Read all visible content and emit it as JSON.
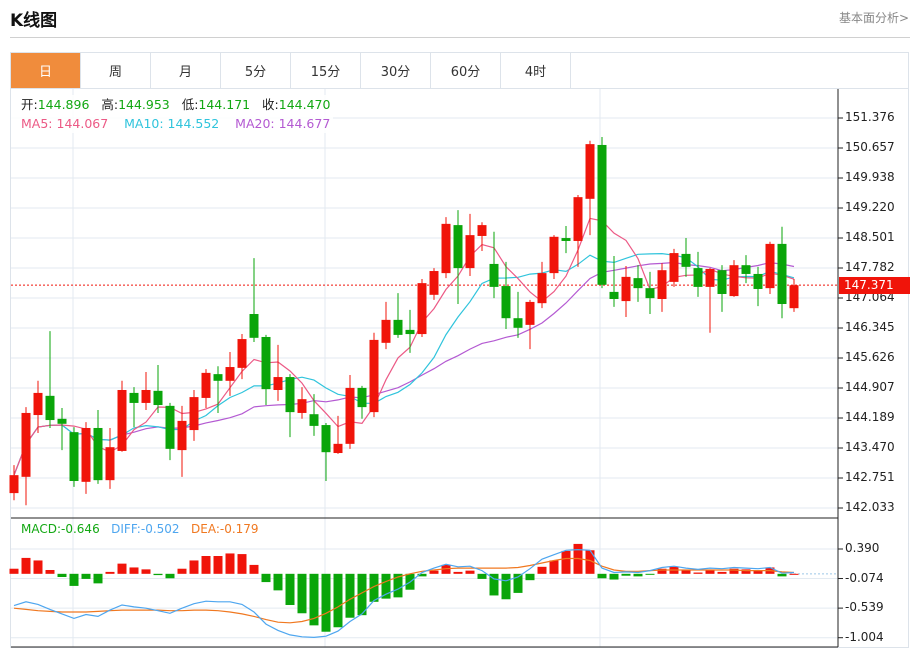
{
  "header": {
    "title": "K线图",
    "link": "基本面分析>"
  },
  "tabs": [
    {
      "label": "日",
      "active": true
    },
    {
      "label": "周"
    },
    {
      "label": "月"
    },
    {
      "label": "5分"
    },
    {
      "label": "15分"
    },
    {
      "label": "30分"
    },
    {
      "label": "60分"
    },
    {
      "label": "4时"
    }
  ],
  "ohlc": {
    "open_label": "开:",
    "open": "144.896",
    "high_label": "高:",
    "high": "144.953",
    "low_label": "低:",
    "low": "144.171",
    "close_label": "收:",
    "close": "144.470"
  },
  "ma": {
    "ma5_label": "MA5:",
    "ma5": "144.067",
    "ma10_label": "MA10:",
    "ma10": "144.552",
    "ma20_label": "MA20:",
    "ma20": "144.677"
  },
  "macd_info": {
    "macd_label": "MACD:",
    "macd": "-0.646",
    "diff_label": "DIFF:",
    "diff": "-0.502",
    "dea_label": "DEA:",
    "dea": "-0.179"
  },
  "last_price": "147.371",
  "colors": {
    "up": "#f0140a",
    "down": "#0aa50a",
    "accent": "#f08c3c",
    "ma5": "#ec5a86",
    "ma10": "#30c4dc",
    "ma20": "#b45ad2",
    "diff": "#4ea6ef",
    "dea": "#f07820"
  },
  "chart_data": [
    {
      "type": "candlestick",
      "y_ticks": [
        "151.376",
        "150.657",
        "149.938",
        "149.220",
        "148.501",
        "147.782",
        "147.064",
        "146.345",
        "145.626",
        "144.907",
        "144.189",
        "143.470",
        "142.751",
        "142.033"
      ],
      "ylim": [
        142.033,
        151.376
      ],
      "grid": true,
      "ohlc": [
        [
          142.39,
          143.06,
          142.22,
          142.82
        ],
        [
          142.78,
          144.45,
          142.1,
          144.31
        ],
        [
          144.26,
          145.08,
          143.83,
          144.79
        ],
        [
          144.72,
          146.27,
          143.95,
          144.14
        ],
        [
          144.17,
          144.43,
          143.42,
          144.05
        ],
        [
          143.85,
          143.97,
          142.54,
          142.68
        ],
        [
          142.66,
          144.09,
          142.37,
          143.95
        ],
        [
          143.95,
          144.38,
          142.61,
          142.7
        ],
        [
          142.7,
          143.95,
          142.49,
          143.49
        ],
        [
          143.4,
          145.08,
          143.38,
          144.86
        ],
        [
          144.79,
          144.93,
          143.97,
          144.55
        ],
        [
          144.55,
          145.29,
          144.38,
          144.86
        ],
        [
          144.84,
          145.46,
          144.31,
          144.5
        ],
        [
          144.48,
          144.55,
          143.18,
          143.45
        ],
        [
          143.42,
          144.48,
          142.78,
          144.12
        ],
        [
          143.9,
          144.86,
          143.64,
          144.69
        ],
        [
          144.67,
          145.36,
          144.43,
          145.27
        ],
        [
          145.24,
          145.43,
          144.31,
          145.08
        ],
        [
          145.08,
          145.77,
          144.72,
          145.41
        ],
        [
          145.39,
          146.2,
          145.12,
          146.08
        ],
        [
          146.68,
          148.02,
          146.01,
          146.11
        ],
        [
          146.13,
          146.18,
          144.5,
          144.88
        ],
        [
          144.86,
          145.94,
          144.6,
          145.17
        ],
        [
          145.17,
          145.24,
          143.73,
          144.33
        ],
        [
          144.31,
          144.93,
          144.17,
          144.64
        ],
        [
          144.28,
          144.76,
          143.76,
          144.0
        ],
        [
          144.02,
          144.07,
          142.68,
          143.37
        ],
        [
          143.35,
          144.24,
          143.33,
          143.57
        ],
        [
          143.57,
          145.22,
          143.45,
          144.91
        ],
        [
          144.91,
          144.96,
          144.17,
          144.45
        ],
        [
          144.33,
          146.23,
          144.21,
          146.06
        ],
        [
          145.99,
          146.97,
          145.84,
          146.54
        ],
        [
          146.54,
          147.18,
          146.11,
          146.18
        ],
        [
          146.3,
          146.78,
          145.75,
          146.2
        ],
        [
          146.2,
          147.52,
          146.13,
          147.42
        ],
        [
          147.14,
          147.78,
          147.02,
          147.71
        ],
        [
          147.66,
          149.0,
          147.54,
          148.84
        ],
        [
          148.81,
          149.17,
          146.92,
          147.78
        ],
        [
          147.78,
          149.08,
          147.59,
          148.57
        ],
        [
          148.55,
          148.88,
          148.19,
          148.81
        ],
        [
          147.88,
          148.65,
          147.06,
          147.33
        ],
        [
          147.35,
          147.93,
          146.32,
          146.58
        ],
        [
          146.58,
          147.21,
          146.11,
          146.35
        ],
        [
          146.42,
          147.02,
          145.84,
          146.97
        ],
        [
          146.94,
          147.93,
          146.82,
          147.66
        ],
        [
          147.66,
          148.57,
          147.52,
          148.53
        ],
        [
          148.5,
          148.79,
          148.14,
          148.43
        ],
        [
          148.43,
          149.53,
          147.81,
          149.48
        ],
        [
          149.44,
          150.83,
          148.57,
          150.75
        ],
        [
          150.73,
          150.92,
          147.3,
          147.38
        ],
        [
          147.21,
          148.07,
          146.85,
          147.04
        ],
        [
          146.99,
          147.83,
          146.61,
          147.57
        ],
        [
          147.54,
          147.85,
          146.97,
          147.3
        ],
        [
          147.3,
          147.69,
          146.68,
          147.06
        ],
        [
          147.04,
          147.9,
          146.73,
          147.73
        ],
        [
          147.45,
          148.24,
          147.33,
          148.14
        ],
        [
          148.12,
          148.5,
          147.57,
          147.81
        ],
        [
          147.78,
          148.17,
          147.09,
          147.33
        ],
        [
          147.33,
          147.78,
          146.23,
          147.76
        ],
        [
          147.73,
          147.85,
          146.73,
          147.16
        ],
        [
          147.11,
          147.97,
          147.09,
          147.85
        ],
        [
          147.85,
          148.09,
          147.42,
          147.64
        ],
        [
          147.64,
          147.81,
          146.87,
          147.28
        ],
        [
          147.3,
          148.41,
          147.16,
          148.36
        ],
        [
          148.36,
          148.77,
          146.58,
          146.92
        ],
        [
          146.82,
          147.52,
          146.73,
          147.37
        ]
      ],
      "series": [
        {
          "name": "MA5"
        },
        {
          "name": "MA10"
        },
        {
          "name": "MA20"
        }
      ]
    },
    {
      "type": "bar+line",
      "y_ticks": [
        "0.390",
        "-0.074",
        "-0.539",
        "-1.004"
      ],
      "ylim": [
        -1.004,
        0.39
      ],
      "grid": true,
      "macd": [
        0.08,
        0.25,
        0.21,
        0.06,
        -0.05,
        -0.19,
        -0.08,
        -0.15,
        0.03,
        0.16,
        0.1,
        0.07,
        -0.02,
        -0.07,
        0.08,
        0.21,
        0.28,
        0.28,
        0.32,
        0.31,
        0.14,
        -0.13,
        -0.26,
        -0.49,
        -0.62,
        -0.81,
        -0.91,
        -0.84,
        -0.69,
        -0.65,
        -0.44,
        -0.39,
        -0.37,
        -0.25,
        -0.04,
        0.05,
        0.14,
        0.03,
        0.05,
        -0.08,
        -0.34,
        -0.4,
        -0.3,
        -0.1,
        0.11,
        0.21,
        0.36,
        0.47,
        0.37,
        -0.07,
        -0.09,
        -0.03,
        -0.04,
        -0.01,
        0.08,
        0.11,
        0.06,
        0.02,
        0.06,
        0.03,
        0.08,
        0.07,
        0.06,
        0.1,
        -0.04,
        0.0
      ],
      "diff": [
        -0.5,
        -0.44,
        -0.48,
        -0.56,
        -0.63,
        -0.7,
        -0.64,
        -0.67,
        -0.57,
        -0.49,
        -0.52,
        -0.54,
        -0.58,
        -0.62,
        -0.54,
        -0.47,
        -0.43,
        -0.44,
        -0.44,
        -0.48,
        -0.6,
        -0.79,
        -0.89,
        -0.96,
        -0.99,
        -1.0,
        -0.98,
        -0.9,
        -0.75,
        -0.63,
        -0.42,
        -0.32,
        -0.24,
        -0.13,
        0.02,
        0.09,
        0.15,
        0.11,
        0.12,
        0.05,
        -0.08,
        -0.11,
        -0.05,
        0.08,
        0.23,
        0.3,
        0.37,
        0.38,
        0.37,
        0.09,
        0.02,
        0.03,
        0.02,
        0.05,
        0.1,
        0.12,
        0.09,
        0.07,
        0.09,
        0.08,
        0.1,
        0.09,
        0.08,
        0.1,
        0.01,
        0.02
      ],
      "dea": [
        -0.54,
        -0.56,
        -0.58,
        -0.59,
        -0.6,
        -0.6,
        -0.6,
        -0.59,
        -0.58,
        -0.57,
        -0.57,
        -0.57,
        -0.57,
        -0.58,
        -0.58,
        -0.57,
        -0.57,
        -0.58,
        -0.6,
        -0.63,
        -0.67,
        -0.72,
        -0.76,
        -0.77,
        -0.75,
        -0.7,
        -0.62,
        -0.52,
        -0.4,
        -0.3,
        -0.2,
        -0.12,
        -0.05,
        0.0,
        0.04,
        0.06,
        0.08,
        0.09,
        0.09,
        0.09,
        0.09,
        0.09,
        0.1,
        0.13,
        0.17,
        0.21,
        0.24,
        0.24,
        0.21,
        0.12,
        0.06,
        0.04,
        0.04,
        0.05,
        0.06,
        0.06,
        0.06,
        0.06,
        0.06,
        0.06,
        0.06,
        0.05,
        0.05,
        0.05,
        0.03,
        0.02
      ]
    }
  ]
}
